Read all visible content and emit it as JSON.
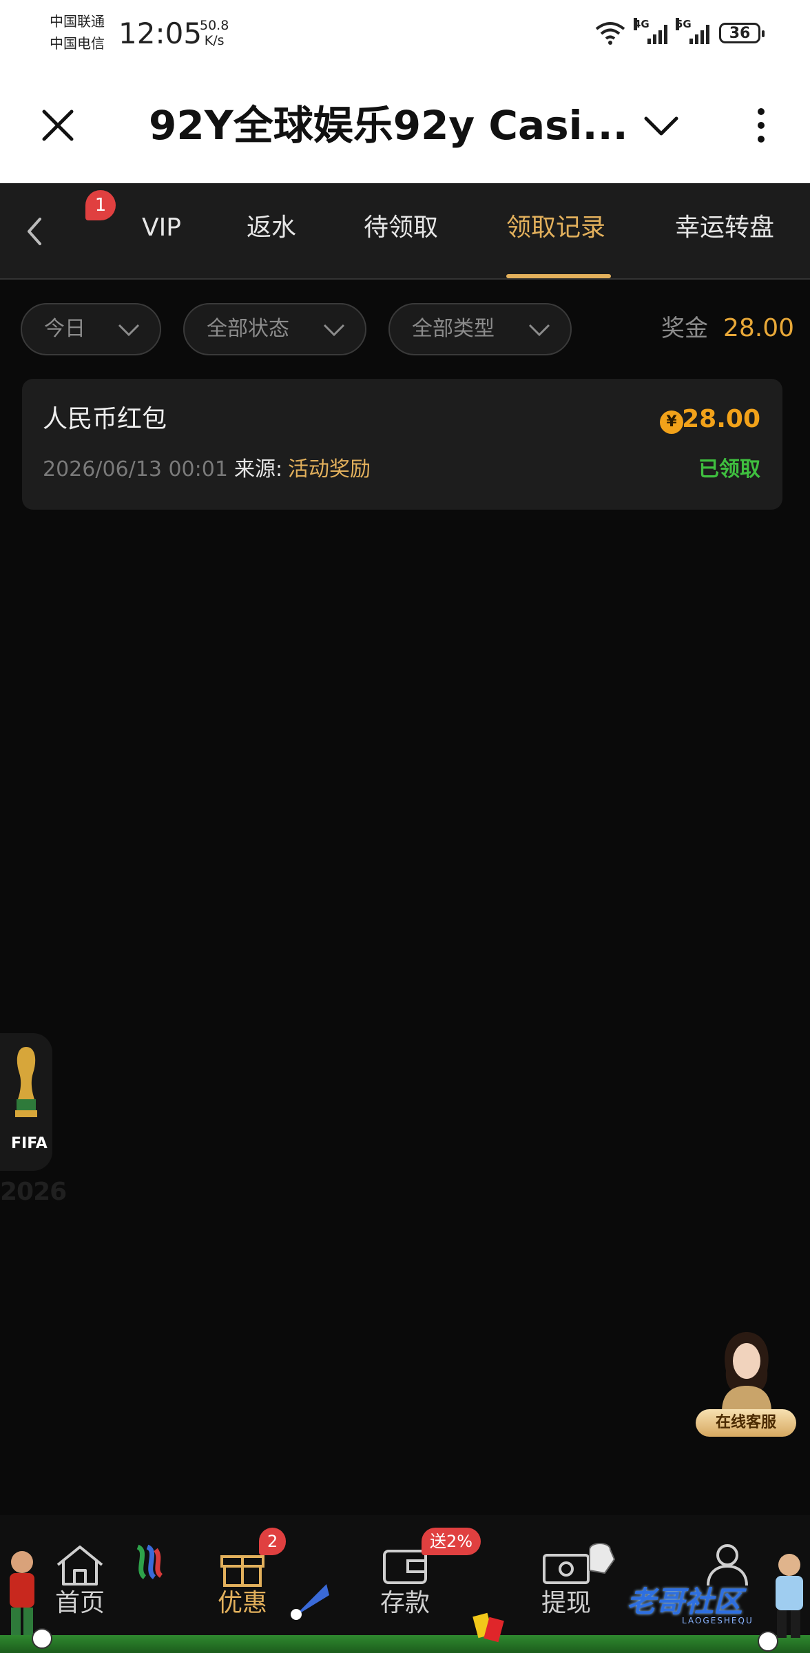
{
  "status_bar": {
    "carrier_1": "中国联通",
    "carrier_2": "中国电信",
    "time": "12:05",
    "net_speed_value": "50.8",
    "net_speed_unit": "K/s",
    "signal_1_label": "4G",
    "signal_2_label": "5G",
    "battery": "36"
  },
  "title_bar": {
    "title": "92Y全球娱乐92y Casi..."
  },
  "tabs": {
    "back_badge": "1",
    "items": [
      {
        "label": "VIP"
      },
      {
        "label": "返水"
      },
      {
        "label": "待领取"
      },
      {
        "label": "领取记录"
      },
      {
        "label": "幸运转盘"
      }
    ],
    "active_index": 3
  },
  "filters": {
    "date": "今日",
    "status": "全部状态",
    "type": "全部类型",
    "bonus_label": "奖金",
    "bonus_value": "28.00"
  },
  "records": [
    {
      "title": "人民币红包",
      "currency_symbol": "¥",
      "amount": "28.00",
      "date": "2026/06/13 00:01",
      "source_label": "来源:",
      "source_value": "活动奖励",
      "status": "已领取"
    }
  ],
  "floating": {
    "fifa_text": "FIFA",
    "fifa_year": "2026",
    "customer_service": "在线客服"
  },
  "bottom_nav": {
    "items": [
      {
        "label": "首页"
      },
      {
        "label": "优惠",
        "badge": "2"
      },
      {
        "label": "存款",
        "badge": "送2%"
      },
      {
        "label": "提现"
      },
      {
        "label": ""
      }
    ]
  },
  "watermark": {
    "text": "老哥社区",
    "sub": "LAOGESHEQU"
  },
  "colors": {
    "accent_gold": "#e2b05c",
    "amount_orange": "#f2a21a",
    "status_green": "#3fbf3f",
    "badge_red": "#e04040",
    "background": "#0a0a0a"
  }
}
